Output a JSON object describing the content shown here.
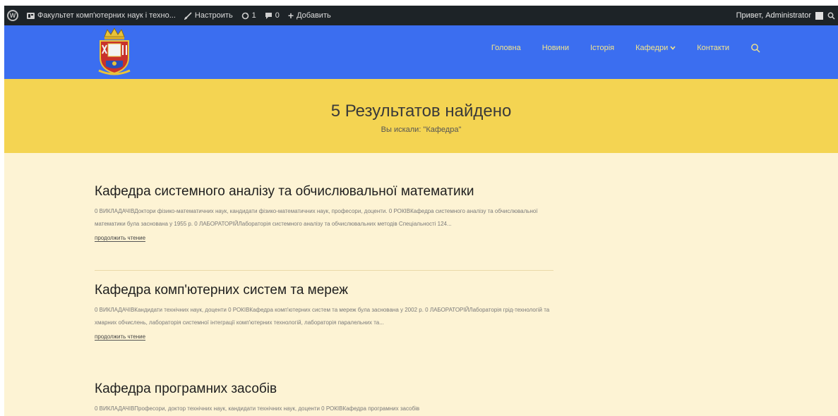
{
  "adminbar": {
    "site_name": "Факультет комп'ютерних наук і техно...",
    "customize_label": "Настроить",
    "updates_count": "1",
    "comments_count": "0",
    "new_label": "Добавить",
    "greeting": "Привет, Administrator"
  },
  "nav": {
    "items": [
      "Головна",
      "Новини",
      "Історія",
      "Кафедри",
      "Контакти"
    ]
  },
  "search": {
    "results_title": "5 Результатов найдено",
    "query_text": "Вы искали: \"Кафедра\""
  },
  "articles": [
    {
      "title": "Кафедра системного аналізу та обчислювальної математики",
      "excerpt": "0 ВИКЛАДАЧІВДоктори фізико-математичних наук, кандидати фізико-математичних наук, професори, доценти. 0 РОКІВКафедра системного аналізу та обчислювальної математики була заснована у 1955 р. 0 ЛАБОРАТОРІЙЛабораторія системного аналізу та обчислювальних методів Спеціальності 124...",
      "read_more": "продолжить чтение"
    },
    {
      "title": "Кафедра комп'ютерних систем та мереж",
      "excerpt": "0 ВИКЛАДАЧІВКандидати технічних наук, доценти 0 РОКІВКафедра комп'ютерних систем та мереж була заснована у 2002 р. 0 ЛАБОРАТОРІЙЛабораторія грід-технологій та хмарних обчислень, лабораторія системної інтеграції комп'ютерних технологій, лабораторія паралельних та...",
      "read_more": "продолжить чтение"
    },
    {
      "title": "Кафедра програмних засобів",
      "excerpt": "0 ВИКЛАДАЧІВПрофесори, доктор технічних наук, кандидати технічних наук, доценти 0 РОКІВКафедра програмних засобів"
    }
  ],
  "colors": {
    "adminbar": "#1d2327",
    "header": "#3b6ef0",
    "banner": "#f4d452",
    "content": "#fdf3d4",
    "nav_text": "#f4e58a"
  },
  "icons": [
    "wordpress-icon",
    "dashboard-icon",
    "brush-icon",
    "updates-icon",
    "comment-icon",
    "plus-icon",
    "search-icon",
    "chevron-down-icon"
  ]
}
